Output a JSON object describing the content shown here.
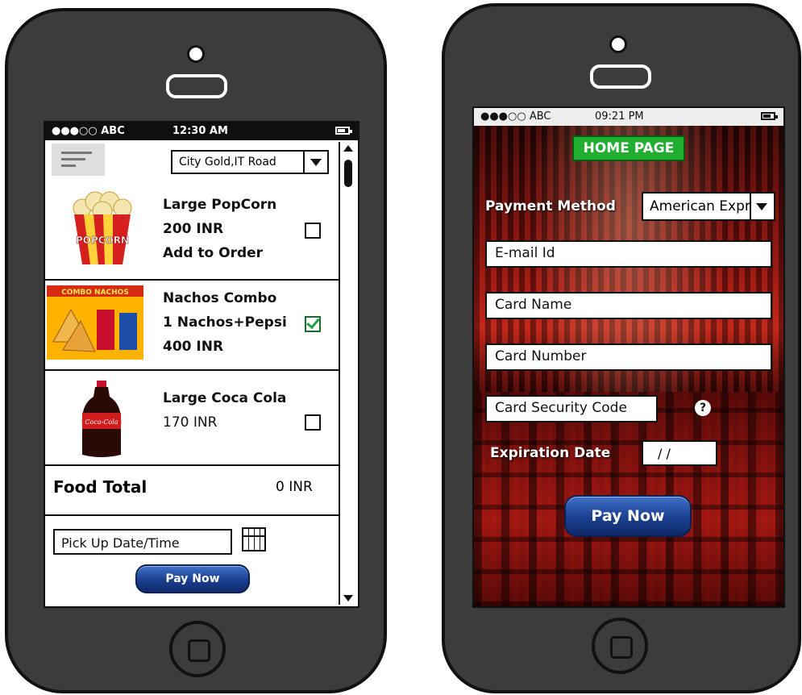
{
  "left_phone": {
    "status": {
      "carrier": "●●●○○ ABC",
      "time": "12:30 AM"
    },
    "location_select": {
      "value": "City Gold,IT Road"
    },
    "items": [
      {
        "name": "Large PopCorn",
        "line2": "200 INR",
        "line3": "Add to Order",
        "checked": false
      },
      {
        "name": "Nachos Combo",
        "line2": "1 Nachos+Pepsi",
        "line3": "400 INR",
        "checked": true
      },
      {
        "name": "Large Coca Cola",
        "line2": "170 INR",
        "line3": "",
        "checked": false
      }
    ],
    "item_images": [
      {
        "caption": "POPCORN"
      },
      {
        "caption": "COMBO NACHOS"
      },
      {
        "caption": "Coca-Cola"
      }
    ],
    "food_total": {
      "label": "Food Total",
      "value": "0 INR"
    },
    "pickup": {
      "placeholder": "Pick Up Date/Time"
    },
    "pay_button": "Pay Now"
  },
  "right_phone": {
    "status": {
      "carrier": "●●●○○ ABC",
      "time": "09:21 PM"
    },
    "title": "HOME PAGE",
    "payment_method": {
      "label": "Payment Method",
      "value": "American Expres"
    },
    "fields": {
      "email": "E-mail Id",
      "card_name": "Card Name",
      "card_number": "Card Number",
      "security_code": "Card Security Code"
    },
    "help_icon": "?",
    "expiration": {
      "label": "Expiration Date",
      "value": "/ /"
    },
    "pay_button": "Pay Now"
  },
  "colors": {
    "phone_body": "#3c3c3c",
    "title_green": "#1fae2f",
    "button_blue": "#1a3f8f",
    "theater_red": "#8a1410"
  }
}
